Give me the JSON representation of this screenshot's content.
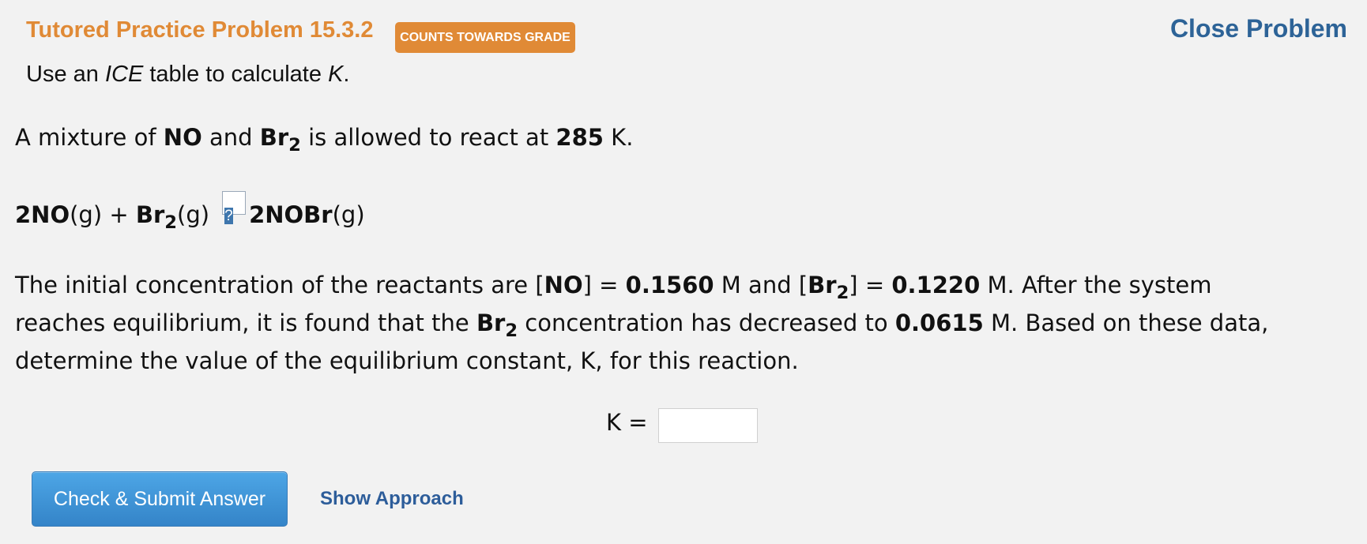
{
  "header": {
    "title": "Tutored Practice Problem 15.3.2",
    "badge": "COUNTS TOWARDS GRADE",
    "close_link": "Close Problem"
  },
  "instruction": {
    "pre": "Use an ",
    "ice": "ICE",
    "mid": " table to calculate ",
    "k": "K",
    "end": "."
  },
  "problem": {
    "p1": {
      "a": "A mixture of ",
      "no": "NO",
      "b": " and ",
      "br": "Br",
      "sub": "2",
      "c": " is allowed to react at ",
      "temp": "285",
      "d": " K."
    },
    "equation": {
      "r1_bold": "2NO",
      "r1_state": "(g) + ",
      "r2_bold": "Br",
      "r2_sub": "2",
      "r2_state": "(g)",
      "help_icon": "?",
      "p_bold": "2NOBr",
      "p_state": "(g)"
    },
    "p3": {
      "a": "The initial concentration of the reactants are [",
      "no": "NO",
      "b": "] = ",
      "no_conc": "0.1560",
      "c": " M and [",
      "br": "Br",
      "sub": "2",
      "d": "] = ",
      "br_conc": "0.1220",
      "e": " M. After the system",
      "f": "reaches equilibrium, it is found that the ",
      "br2": "Br",
      "sub2": "2",
      "g": " concentration has decreased to ",
      "eq_conc": "0.0615",
      "h": " M. Based on these data,",
      "i": "determine the value of the equilibrium constant, K, for this reaction."
    }
  },
  "answer": {
    "label": "K =",
    "value": ""
  },
  "actions": {
    "submit": "Check & Submit Answer",
    "approach": "Show Approach"
  }
}
